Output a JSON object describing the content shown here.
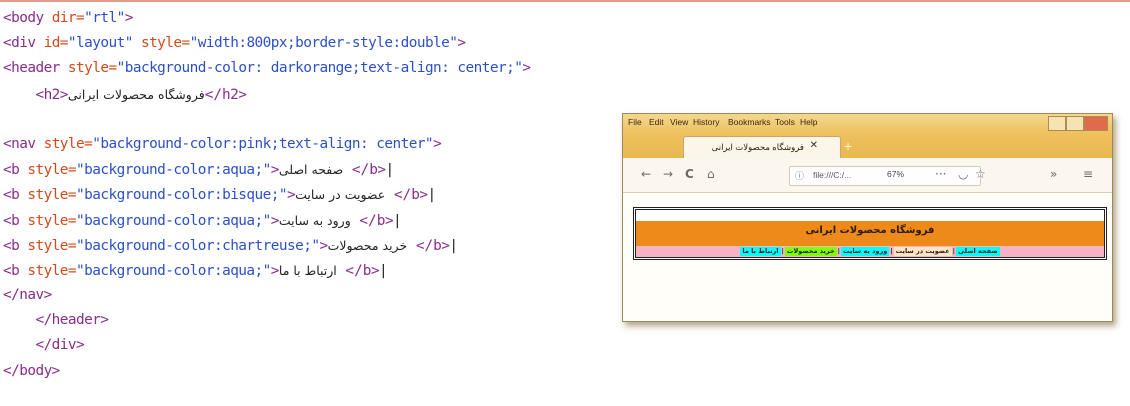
{
  "code_lines": [
    [
      {
        "c": "tag",
        "t": "<body "
      },
      {
        "c": "attr",
        "t": "dir="
      },
      {
        "c": "val",
        "t": "\"rtl\""
      },
      {
        "c": "tag",
        "t": ">"
      }
    ],
    [
      {
        "c": "tag",
        "t": "<div "
      },
      {
        "c": "attr",
        "t": "id="
      },
      {
        "c": "val",
        "t": "\"layout\" "
      },
      {
        "c": "attr",
        "t": "style="
      },
      {
        "c": "val",
        "t": "\"width:800px;border-style:double\""
      },
      {
        "c": "tag",
        "t": ">"
      }
    ],
    [
      {
        "c": "tag",
        "t": "<header "
      },
      {
        "c": "attr",
        "t": "style="
      },
      {
        "c": "val",
        "t": "\"background-color: darkorange;text-align: center;\""
      },
      {
        "c": "tag",
        "t": ">"
      }
    ],
    [
      {
        "c": "tag",
        "t": "    <h2>"
      },
      {
        "c": "rtl",
        "t": "فروشگاه محصولات ایرانی"
      },
      {
        "c": "tag",
        "t": "</h2>"
      }
    ],
    [],
    [
      {
        "c": "tag",
        "t": "<nav "
      },
      {
        "c": "attr",
        "t": "style="
      },
      {
        "c": "val",
        "t": "\"background-color:pink;text-align: center\""
      },
      {
        "c": "tag",
        "t": ">"
      }
    ],
    [
      {
        "c": "tag",
        "t": "<b "
      },
      {
        "c": "attr",
        "t": "style="
      },
      {
        "c": "val",
        "t": "\"background-color:aqua;\""
      },
      {
        "c": "tag",
        "t": ">"
      },
      {
        "c": "rtl",
        "t": "صفحه اصلی"
      },
      {
        "c": "tag",
        "t": " </b>"
      },
      {
        "c": "bar",
        "t": "|"
      }
    ],
    [
      {
        "c": "tag",
        "t": "<b "
      },
      {
        "c": "attr",
        "t": "style="
      },
      {
        "c": "val",
        "t": "\"background-color:bisque;\""
      },
      {
        "c": "tag",
        "t": ">"
      },
      {
        "c": "rtl",
        "t": "عضویت در سایت"
      },
      {
        "c": "tag",
        "t": " </b>"
      },
      {
        "c": "bar",
        "t": "|"
      }
    ],
    [
      {
        "c": "tag",
        "t": "<b "
      },
      {
        "c": "attr",
        "t": "style="
      },
      {
        "c": "val",
        "t": "\"background-color:aqua;\""
      },
      {
        "c": "tag",
        "t": ">"
      },
      {
        "c": "rtl",
        "t": "ورود به سایت"
      },
      {
        "c": "tag",
        "t": " </b>"
      },
      {
        "c": "bar",
        "t": "|"
      }
    ],
    [
      {
        "c": "tag",
        "t": "<b "
      },
      {
        "c": "attr",
        "t": "style="
      },
      {
        "c": "val",
        "t": "\"background-color:chartreuse;\""
      },
      {
        "c": "tag",
        "t": ">"
      },
      {
        "c": "rtl",
        "t": "خرید محصولات"
      },
      {
        "c": "tag",
        "t": " </b>"
      },
      {
        "c": "bar",
        "t": "|"
      }
    ],
    [
      {
        "c": "tag",
        "t": "<b "
      },
      {
        "c": "attr",
        "t": "style="
      },
      {
        "c": "val",
        "t": "\"background-color:aqua;\""
      },
      {
        "c": "tag",
        "t": ">"
      },
      {
        "c": "rtl",
        "t": "ارتباط با ما"
      },
      {
        "c": "tag",
        "t": " </b>"
      },
      {
        "c": "bar",
        "t": "|"
      }
    ],
    [
      {
        "c": "tag",
        "t": "</nav>"
      }
    ],
    [
      {
        "c": "tag",
        "t": "    </header>"
      }
    ],
    [
      {
        "c": "tag",
        "t": "    </div>"
      }
    ],
    [
      {
        "c": "tag",
        "t": "</body>"
      }
    ]
  ],
  "browser": {
    "menu": [
      "File",
      "Edit",
      "View",
      "History",
      "Bookmarks",
      "Tools",
      "Help"
    ],
    "tab_title": "فروشگاه محصولات ایرانی",
    "tab_close": "✕",
    "new_tab": "+",
    "nav_icons": {
      "back": "←",
      "forward": "→",
      "reload": "C",
      "home": "⌂"
    },
    "url": "file:///C:/...",
    "info_icon": "ⓘ",
    "zoom": "67%",
    "more_icon": "···",
    "pocket_icon": "◡",
    "star_icon": "☆",
    "overflow_icon": "»",
    "menu_icon": "≡"
  },
  "page": {
    "heading": "فروشگاه محصولات ایرانی",
    "nav_items": [
      {
        "label": "صفحه اصلی",
        "color": "#00ffff"
      },
      {
        "label": "عضویت در سایت",
        "color": "#ffe4c4"
      },
      {
        "label": "ورود به سایت",
        "color": "#00ffff"
      },
      {
        "label": "خرید محصولات",
        "color": "#7fff00"
      },
      {
        "label": "ارتباط با ما",
        "color": "#00ffff"
      }
    ]
  }
}
